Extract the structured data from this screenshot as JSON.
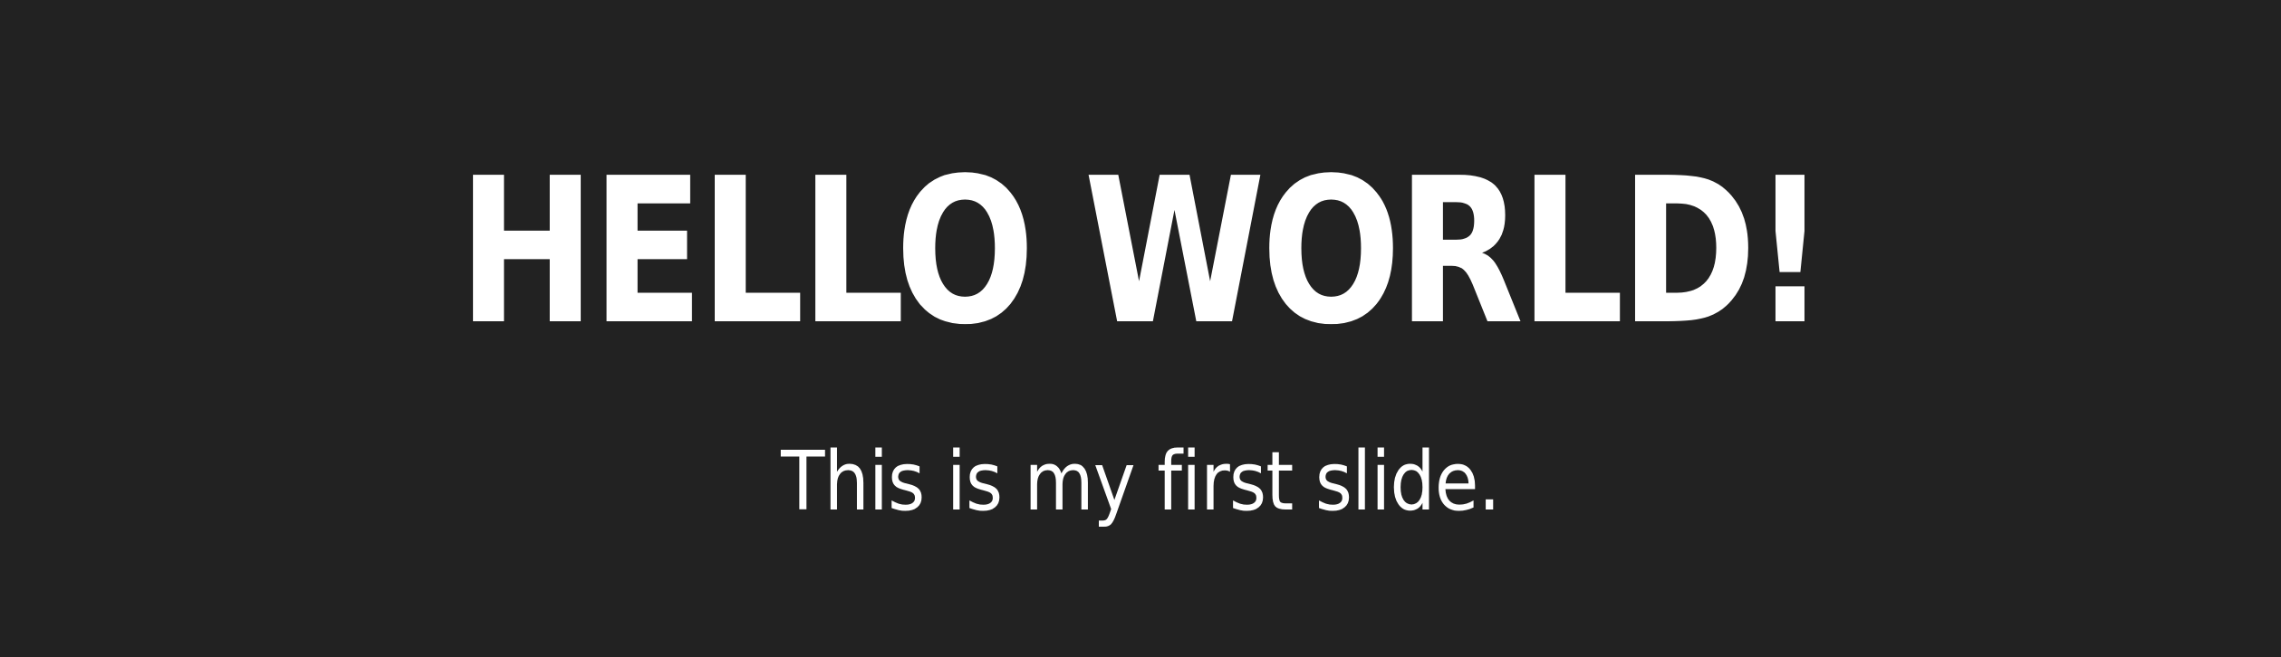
{
  "slide": {
    "title": "HELLO WORLD!",
    "subtitle": "This is my first slide.",
    "colors": {
      "background": "#222222",
      "text": "#ffffff"
    }
  }
}
